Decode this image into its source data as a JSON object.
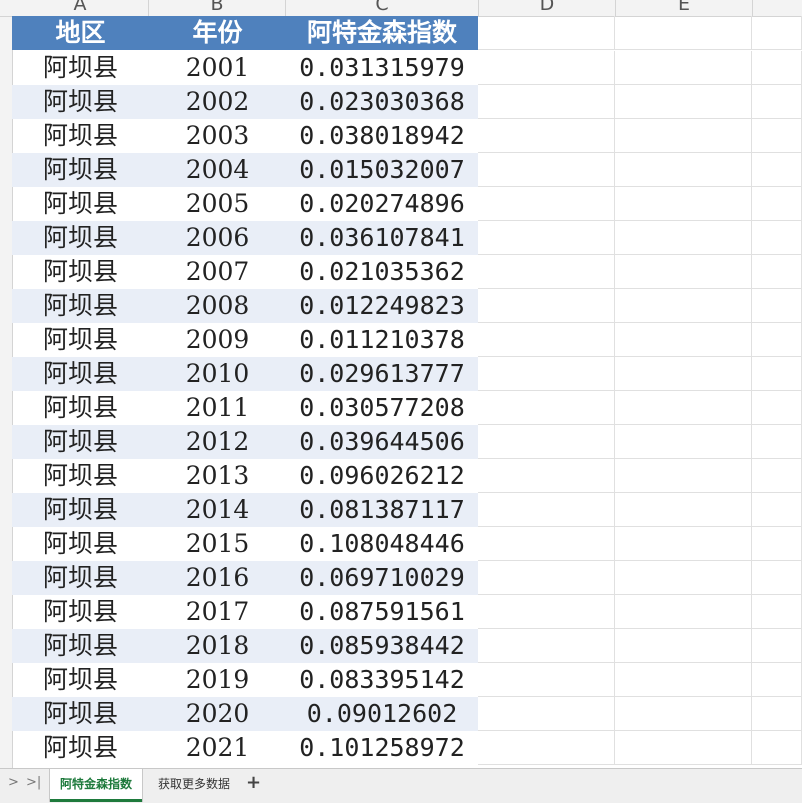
{
  "columns": [
    "A",
    "B",
    "C",
    "D",
    "E"
  ],
  "table": {
    "headers": {
      "region": "地区",
      "year": "年份",
      "index": "阿特金森指数"
    },
    "rows": [
      {
        "region": "阿坝县",
        "year": "2001",
        "index": "0.031315979"
      },
      {
        "region": "阿坝县",
        "year": "2002",
        "index": "0.023030368"
      },
      {
        "region": "阿坝县",
        "year": "2003",
        "index": "0.038018942"
      },
      {
        "region": "阿坝县",
        "year": "2004",
        "index": "0.015032007"
      },
      {
        "region": "阿坝县",
        "year": "2005",
        "index": "0.020274896"
      },
      {
        "region": "阿坝县",
        "year": "2006",
        "index": "0.036107841"
      },
      {
        "region": "阿坝县",
        "year": "2007",
        "index": "0.021035362"
      },
      {
        "region": "阿坝县",
        "year": "2008",
        "index": "0.012249823"
      },
      {
        "region": "阿坝县",
        "year": "2009",
        "index": "0.011210378"
      },
      {
        "region": "阿坝县",
        "year": "2010",
        "index": "0.029613777"
      },
      {
        "region": "阿坝县",
        "year": "2011",
        "index": "0.030577208"
      },
      {
        "region": "阿坝县",
        "year": "2012",
        "index": "0.039644506"
      },
      {
        "region": "阿坝县",
        "year": "2013",
        "index": "0.096026212"
      },
      {
        "region": "阿坝县",
        "year": "2014",
        "index": "0.081387117"
      },
      {
        "region": "阿坝县",
        "year": "2015",
        "index": "0.108048446"
      },
      {
        "region": "阿坝县",
        "year": "2016",
        "index": "0.069710029"
      },
      {
        "region": "阿坝县",
        "year": "2017",
        "index": "0.087591561"
      },
      {
        "region": "阿坝县",
        "year": "2018",
        "index": "0.085938442"
      },
      {
        "region": "阿坝县",
        "year": "2019",
        "index": "0.083395142"
      },
      {
        "region": "阿坝县",
        "year": "2020",
        "index": "0.09012602"
      },
      {
        "region": "阿坝县",
        "year": "2021",
        "index": "0.101258972"
      }
    ]
  },
  "sheet_tabs": [
    {
      "label": "阿特金森指数",
      "active": true
    },
    {
      "label": "获取更多数据",
      "active": false
    }
  ],
  "tabbar": {
    "prev": ">",
    "last": ">|",
    "add": "+"
  },
  "colors": {
    "header_bg": "#4f81bd",
    "band_bg": "#e9eef7",
    "active_tab": "#1e7a3c"
  }
}
